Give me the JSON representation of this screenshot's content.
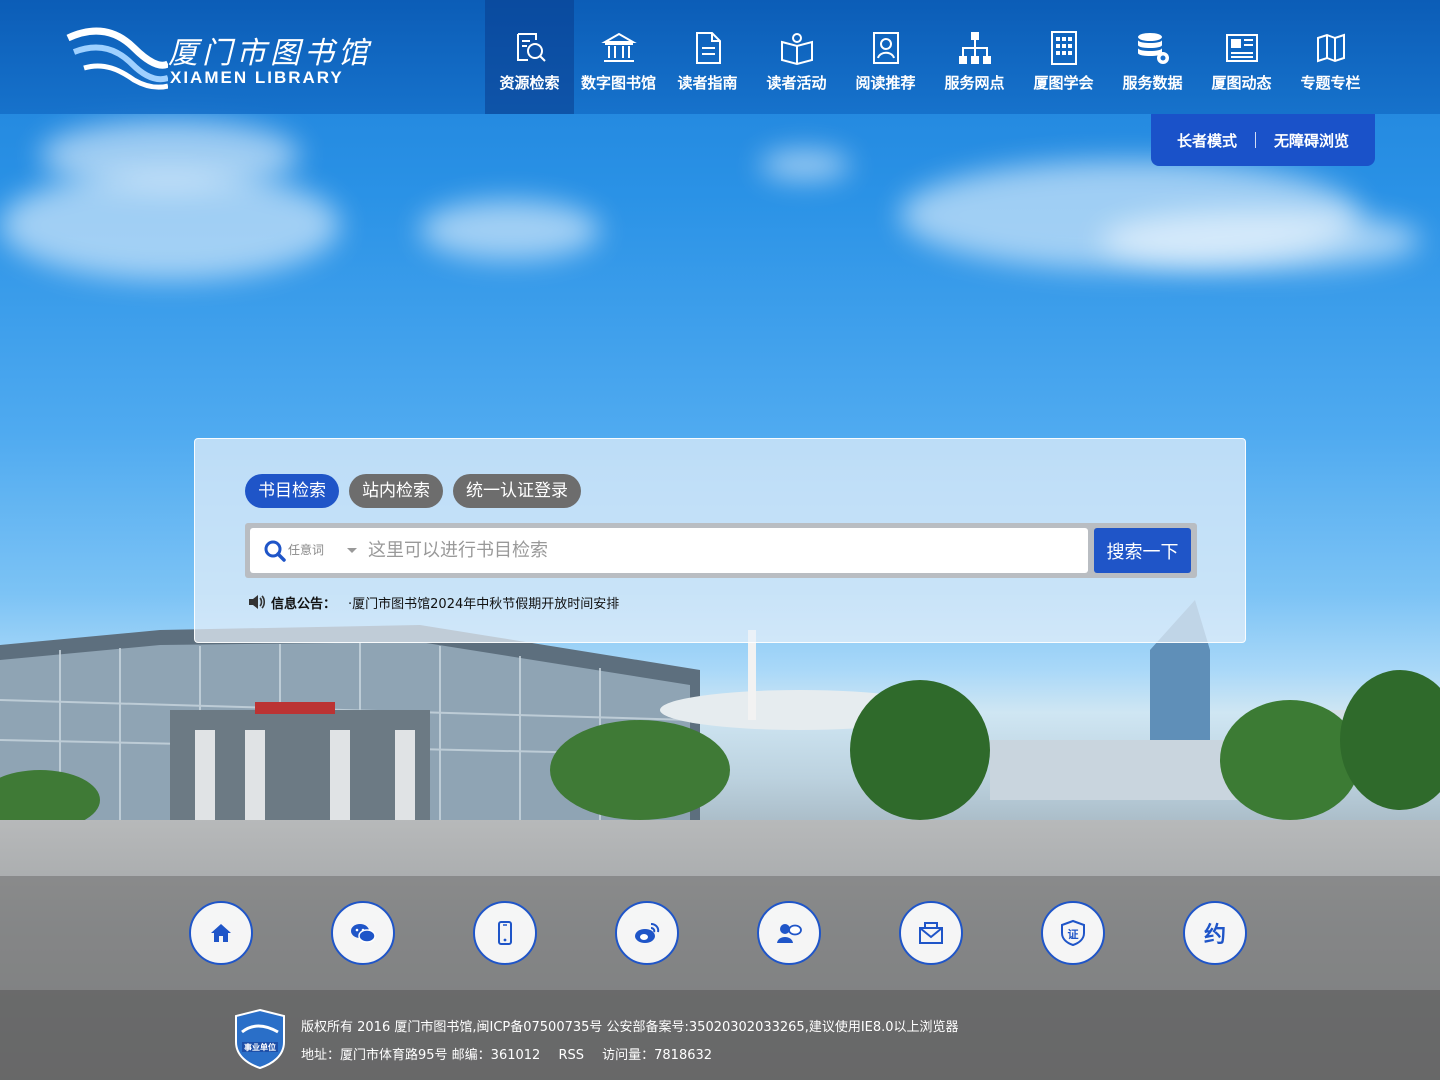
{
  "header": {
    "logo_cn": "厦门市图书馆",
    "logo_en": "XIAMEN LIBRARY",
    "nav": [
      {
        "label": "资源检索",
        "icon": "search-document-icon",
        "active": true
      },
      {
        "label": "数字图书馆",
        "icon": "library-building-icon",
        "active": false
      },
      {
        "label": "读者指南",
        "icon": "document-icon",
        "active": false
      },
      {
        "label": "读者活动",
        "icon": "open-book-icon",
        "active": false
      },
      {
        "label": "阅读推荐",
        "icon": "reader-profile-icon",
        "active": false
      },
      {
        "label": "服务网点",
        "icon": "network-icon",
        "active": false
      },
      {
        "label": "厦图学会",
        "icon": "building-grid-icon",
        "active": false
      },
      {
        "label": "服务数据",
        "icon": "database-gear-icon",
        "active": false
      },
      {
        "label": "厦图动态",
        "icon": "newspaper-icon",
        "active": false
      },
      {
        "label": "专题专栏",
        "icon": "book-column-icon",
        "active": false
      }
    ]
  },
  "modes": {
    "elder": "长者模式",
    "accessible": "无障碍浏览"
  },
  "search": {
    "tabs": [
      {
        "label": "书目检索",
        "active": true
      },
      {
        "label": "站内检索",
        "active": false
      },
      {
        "label": "统一认证登录",
        "active": false
      }
    ],
    "scope": "任意词",
    "placeholder": "这里可以进行书目检索",
    "button": "搜索一下",
    "notice_label": "信息公告：",
    "notice_text": "·厦门市图书馆2024年中秋节假期开放时间安排"
  },
  "quick_links": [
    {
      "icon": "home-icon"
    },
    {
      "icon": "wechat-icon"
    },
    {
      "icon": "mobile-icon"
    },
    {
      "icon": "weibo-icon"
    },
    {
      "icon": "user-chat-icon"
    },
    {
      "icon": "mail-icon"
    },
    {
      "icon": "certificate-icon",
      "text": "证"
    },
    {
      "icon": "appointment-icon",
      "text": "约"
    }
  ],
  "footer": {
    "line1": "版权所有 2016 厦门市图书馆,闽ICP备07500735号 公安部备案号:35020302033265,建议使用IE8.0以上浏览器",
    "address": "地址：厦门市体育路95号 邮编：361012",
    "rss": "RSS",
    "visits": "访问量：7818632",
    "badge_text": "事业单位"
  },
  "colors": {
    "primary": "#1f55c8",
    "header": "#0f64c0",
    "tab_inactive": "#6d6d6d"
  }
}
